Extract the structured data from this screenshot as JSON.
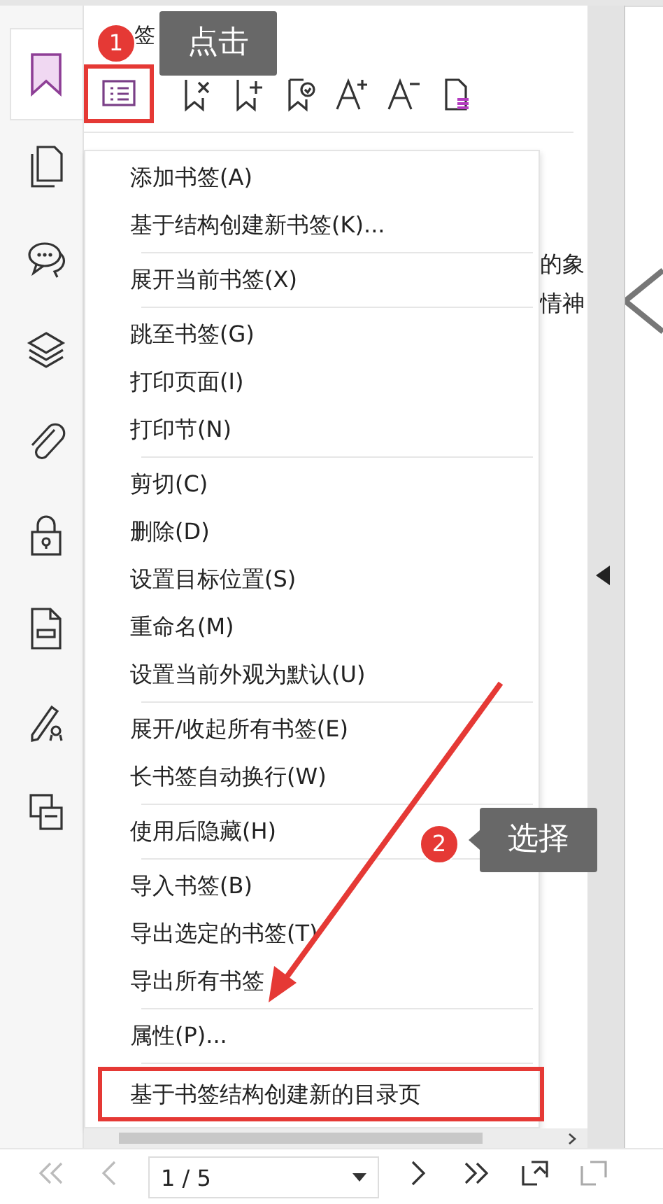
{
  "sidebar": {
    "tabs": [
      {
        "selected": true
      },
      {
        "selected": false
      },
      {
        "selected": false
      },
      {
        "selected": false
      },
      {
        "selected": false
      },
      {
        "selected": false
      },
      {
        "selected": false
      },
      {
        "selected": false
      },
      {
        "selected": false
      }
    ]
  },
  "bookmarks_panel": {
    "title": "签",
    "toolbar": [
      {
        "outlined": true
      },
      {
        "outlined": false
      },
      {
        "outlined": false
      },
      {
        "outlined": false
      },
      {
        "outlined": false
      },
      {
        "outlined": false
      },
      {
        "outlined": false
      }
    ]
  },
  "document": {
    "lines": [
      "的象",
      "情神"
    ]
  },
  "context_menu": {
    "groups": [
      [
        {
          "label": "添加书签(A)",
          "outlined": false
        },
        {
          "label": "基于结构创建新书签(K)...",
          "outlined": false
        }
      ],
      [
        {
          "label": "展开当前书签(X)",
          "outlined": false
        }
      ],
      [
        {
          "label": "跳至书签(G)",
          "outlined": false
        },
        {
          "label": "打印页面(I)",
          "outlined": false
        },
        {
          "label": "打印节(N)",
          "outlined": false
        }
      ],
      [
        {
          "label": "剪切(C)",
          "outlined": false
        },
        {
          "label": "删除(D)",
          "outlined": false
        },
        {
          "label": "设置目标位置(S)",
          "outlined": false
        },
        {
          "label": "重命名(M)",
          "outlined": false
        },
        {
          "label": "设置当前外观为默认(U)",
          "outlined": false
        }
      ],
      [
        {
          "label": "展开/收起所有书签(E)",
          "outlined": false
        },
        {
          "label": "长书签自动换行(W)",
          "outlined": false
        }
      ],
      [
        {
          "label": "使用后隐藏(H)",
          "outlined": false
        }
      ],
      [
        {
          "label": "导入书签(B)",
          "outlined": false
        },
        {
          "label": "导出选定的书签(T)",
          "outlined": false
        },
        {
          "label": "导出所有书签",
          "outlined": false
        }
      ],
      [
        {
          "label": "属性(P)...",
          "outlined": false
        }
      ],
      [
        {
          "label": "基于书签结构创建新的目录页",
          "outlined": true
        }
      ]
    ]
  },
  "page_nav": {
    "page": "1 / 5"
  },
  "annotations": [
    {
      "number": "1",
      "label": "点击"
    },
    {
      "number": "2",
      "label": "选择"
    }
  ]
}
